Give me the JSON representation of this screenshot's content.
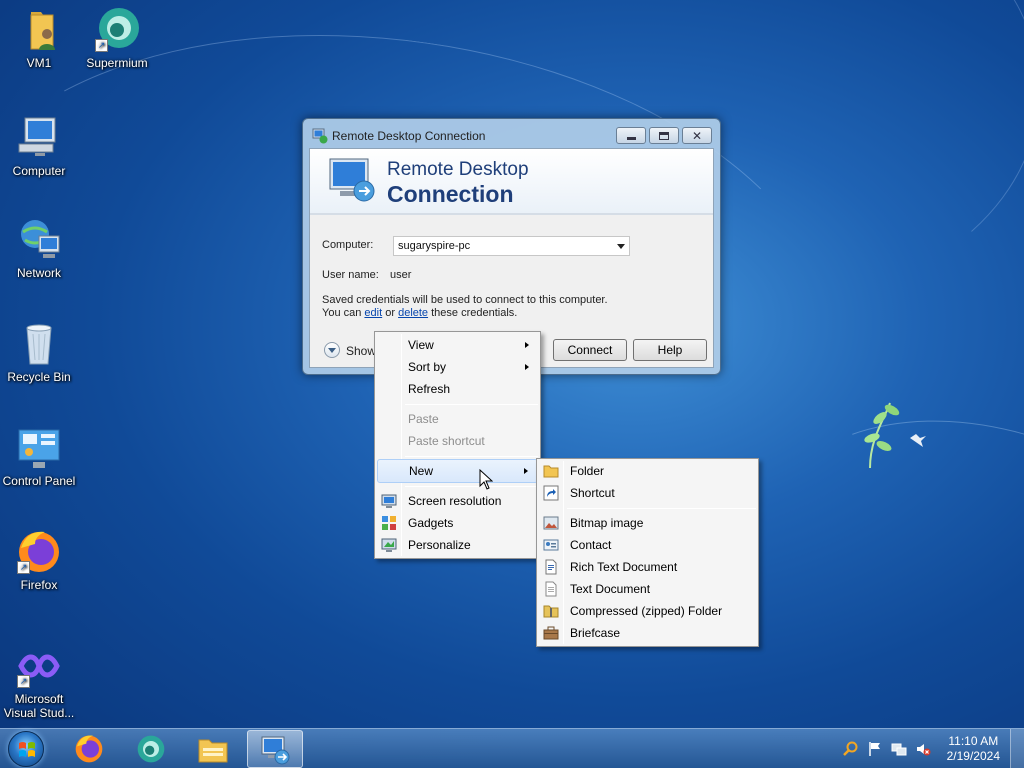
{
  "desktop": {
    "icons": [
      {
        "label": "VM1",
        "icon": "user-folder-icon"
      },
      {
        "label": "Supermium",
        "icon": "supermium-browser-icon"
      },
      {
        "label": "Computer",
        "icon": "computer-icon"
      },
      {
        "label": "Network",
        "icon": "network-icon"
      },
      {
        "label": "Recycle Bin",
        "icon": "recycle-bin-icon"
      },
      {
        "label": "Control Panel",
        "icon": "control-panel-icon"
      },
      {
        "label": "Firefox",
        "icon": "firefox-icon"
      },
      {
        "label": "Microsoft Visual Stud...",
        "icon": "visual-studio-icon"
      }
    ]
  },
  "rdp": {
    "title": "Remote Desktop Connection",
    "banner_line1": "Remote Desktop",
    "banner_line2": "Connection",
    "computer_label": "Computer:",
    "computer_value": "sugaryspire-pc",
    "username_label": "User name:",
    "username_value": "user",
    "cred_line1": "Saved credentials will be used to connect to this computer.",
    "cred_line2_prefix": "You can",
    "cred_edit": "edit",
    "cred_or": "or",
    "cred_delete": "delete",
    "cred_suffix": "these credentials.",
    "show_options": "Show",
    "connect": "Connect",
    "help": "Help"
  },
  "context_menu": {
    "view": "View",
    "sort_by": "Sort by",
    "refresh": "Refresh",
    "paste": "Paste",
    "paste_shortcut": "Paste shortcut",
    "new": "New",
    "screen_resolution": "Screen resolution",
    "gadgets": "Gadgets",
    "personalize": "Personalize"
  },
  "new_submenu": {
    "folder": "Folder",
    "shortcut": "Shortcut",
    "bitmap": "Bitmap image",
    "contact": "Contact",
    "rich_text": "Rich Text Document",
    "text_doc": "Text Document",
    "zip_folder": "Compressed (zipped) Folder",
    "briefcase": "Briefcase"
  },
  "taskbar": {
    "time": "11:10 AM",
    "date": "2/19/2024",
    "pinned": [
      "firefox-icon",
      "supermium-browser-icon",
      "file-explorer-icon",
      "remote-desktop-icon"
    ]
  },
  "colors": {
    "desktop_blue": "#1f63b4",
    "banner_text": "#1f3f7a",
    "menu_highlight": "#d9e8fb",
    "link": "#0645ad"
  }
}
